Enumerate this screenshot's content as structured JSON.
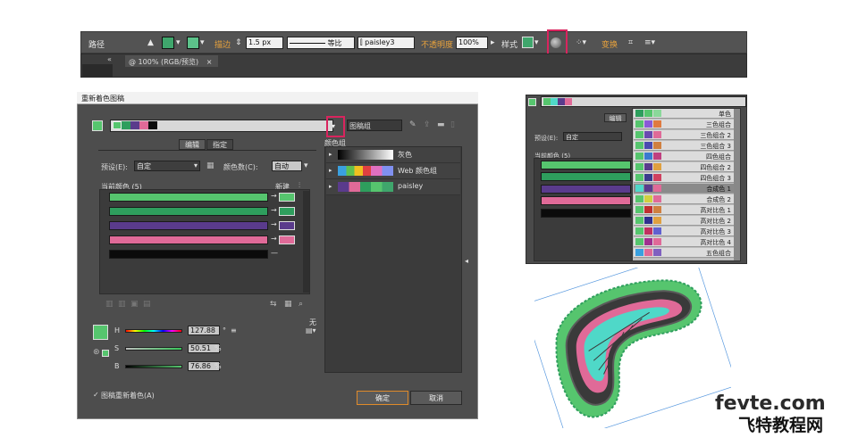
{
  "control_bar": {
    "path_label": "路径",
    "stroke_label": "描边",
    "stroke_width": "1.5 px",
    "profile_label": "等比",
    "brush_name": "paisley3",
    "opacity_label": "不透明度",
    "opacity_value": "100%",
    "style_label": "样式",
    "transform_label": "变换"
  },
  "doc_tab": {
    "label": "@ 100% (RGB/预览)",
    "close": "×",
    "collapse": "«"
  },
  "dialog": {
    "title": "重新着色图稿",
    "tabs": [
      "编辑",
      "指定"
    ],
    "preset_label": "预设(E):",
    "preset_value": "自定",
    "colors_label": "颜色数(C):",
    "colors_value": "自动",
    "current_colors_label": "当前颜色 (5)",
    "new_label": "新建",
    "group_name": "图稿组",
    "color_groups_label": "颜色组",
    "groups": [
      "灰色",
      "Web 颜色组",
      "paisley"
    ],
    "hsb": {
      "h_label": "H",
      "h_value": "127.88",
      "h_unit": "°",
      "s_label": "S",
      "s_value": "50.51",
      "s_unit": "%",
      "b_label": "B",
      "b_value": "76.86",
      "b_unit": "%"
    },
    "none_label": "无",
    "recolor_checkbox": "图稿重新着色(A)",
    "ok_label": "确定",
    "cancel_label": "取消"
  },
  "palette": {
    "tab_edit": "编辑",
    "preset_label": "预设(E):",
    "preset_value": "自定",
    "current_colors_label": "当前颜色 (5)",
    "color_groups": [
      "单色",
      "三色组合",
      "三色组合 2",
      "三色组合 3",
      "四色组合",
      "四色组合 2",
      "四色组合 3",
      "合成色 1",
      "合成色 2",
      "高对比色 1",
      "高对比色 2",
      "高对比色 3",
      "高对比色 4",
      "五色组合"
    ]
  },
  "watermark": {
    "line1": "fevte.com",
    "line2": "飞特教程网"
  },
  "colors": {
    "current": [
      "#56c56e",
      "#2e9e5d",
      "#5a3b8c",
      "#e06a98",
      "#0b0b0b"
    ],
    "accent_red": "#d9245e",
    "panel_dark": "#3b3b3b"
  }
}
